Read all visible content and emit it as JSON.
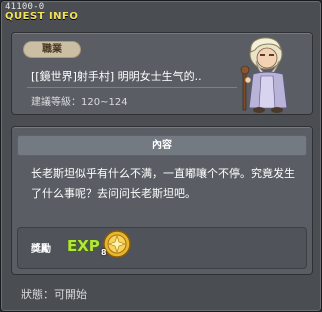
{
  "window": {
    "quest_id": "41100-0",
    "title": "QUEST INFO"
  },
  "quest": {
    "job_label": "職業",
    "name": "[[鏡世界]射手村] 明明女士生气的..",
    "required_level": "建議等級：120~124",
    "npc_icon": "old-man-npc-icon"
  },
  "content": {
    "header": "內容",
    "text": "长老斯坦似乎有什么不满，一直嘟嚷个不停。究竟发生了什么事呢？去问问长老斯坦吧。"
  },
  "reward": {
    "label": "獎勵",
    "exp_icon": "exp-icon",
    "medal_icon": "medal-icon",
    "count": "8"
  },
  "status": {
    "text": "狀態：可開始"
  },
  "colors": {
    "title": "#f2e15a",
    "window_bg": "#4a4d52",
    "panel_bg": "#5a5e64",
    "badge_bg": "#cbbfa3"
  }
}
